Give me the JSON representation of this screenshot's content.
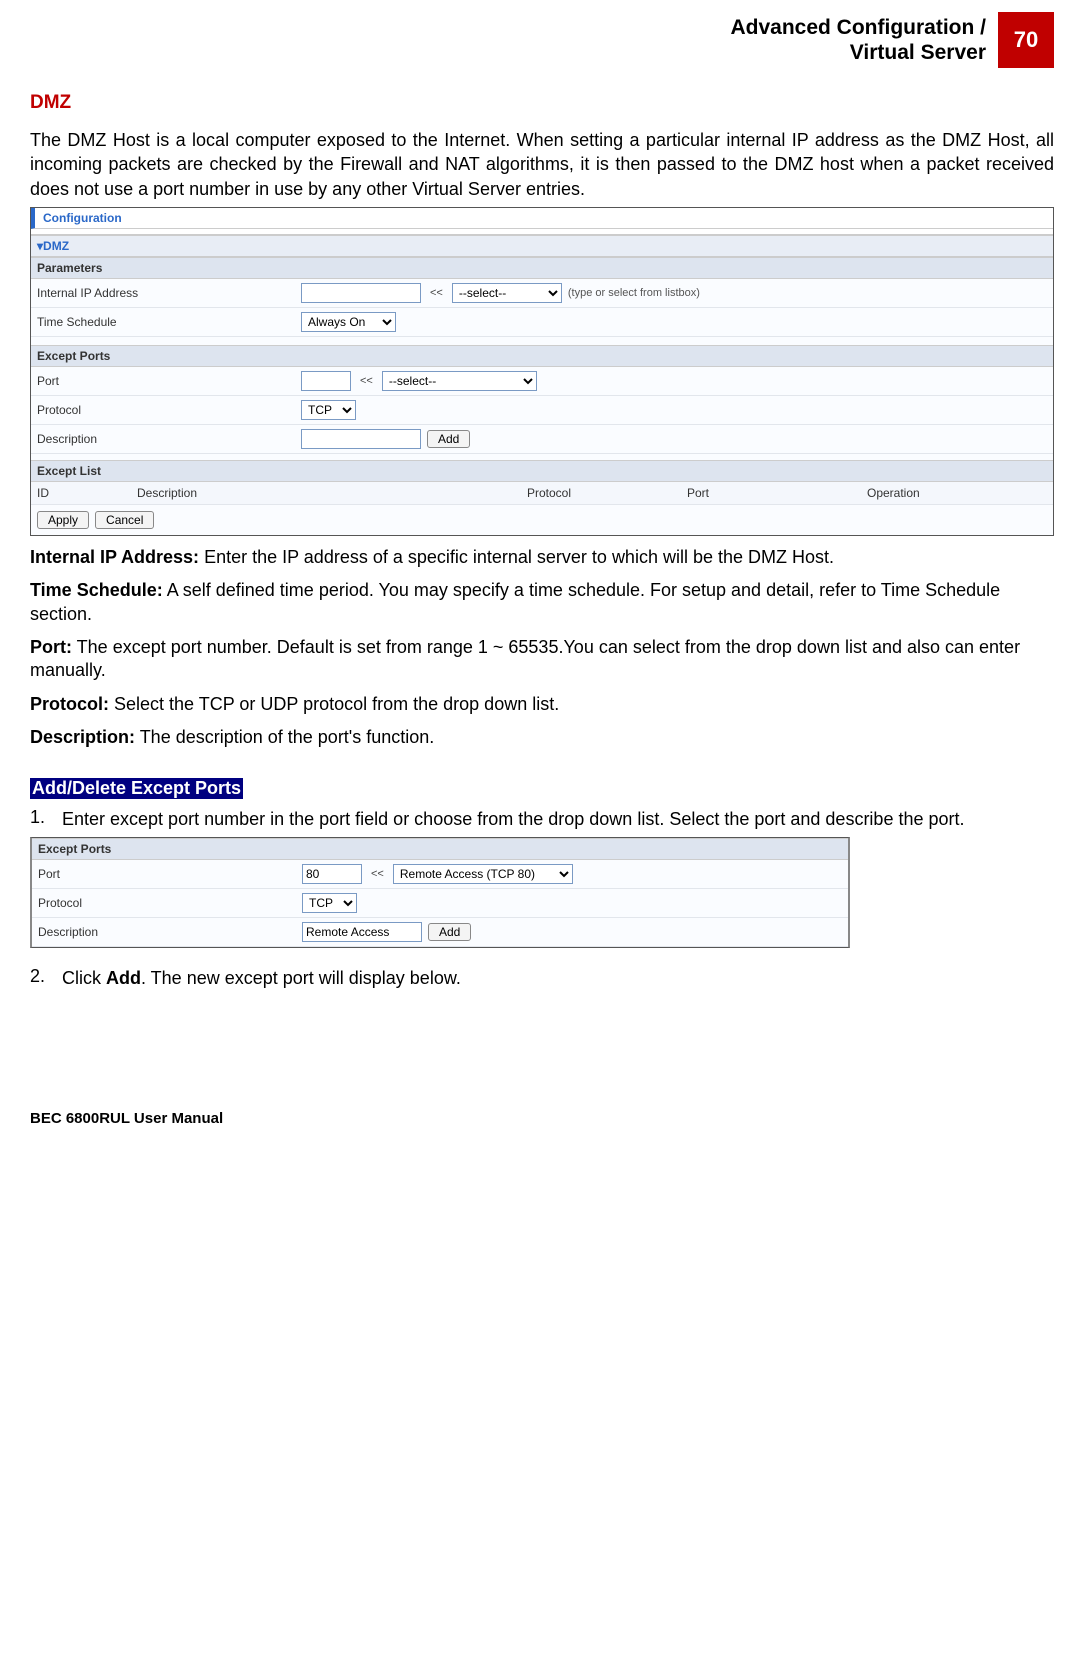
{
  "header": {
    "line1": "Advanced Configuration /",
    "line2": "Virtual Server",
    "page_number": "70"
  },
  "dmz_title": "DMZ",
  "intro": "The DMZ Host is a local computer exposed to the Internet. When setting a particular internal IP address as the DMZ Host, all incoming packets are checked by the Firewall and NAT algorithms, it is then passed to the DMZ host when a packet received does not use a port number in use by any other Virtual Server entries.",
  "ui1": {
    "config_tab": "Configuration",
    "dmz_section": "DMZ",
    "parameters": "Parameters",
    "rows": {
      "internal_ip_label": "Internal IP Address",
      "internal_ip_value": "",
      "ip_select_label": "--select--",
      "ip_hint": "(type or select from listbox)",
      "time_label": "Time Schedule",
      "time_value": "Always On"
    },
    "except_ports": "Except Ports",
    "port_label": "Port",
    "port_value": "",
    "port_select": "--select--",
    "protocol_label": "Protocol",
    "protocol_value": "TCP",
    "desc_label": "Description",
    "desc_value": "",
    "add_btn": "Add",
    "except_list": "Except List",
    "cols": {
      "id": "ID",
      "desc": "Description",
      "protocol": "Protocol",
      "port": "Port",
      "operation": "Operation"
    },
    "apply": "Apply",
    "cancel": "Cancel",
    "arrow": "<<"
  },
  "descs": {
    "ip_b": "Internal IP Address:",
    "ip_t": " Enter the IP address of a specific internal server to which will be the DMZ Host.",
    "ts_b": "Time Schedule:",
    "ts_t": " A self defined time period. You may specify a time schedule. For setup and detail, refer to Time Schedule section.",
    "port_b": "Port:",
    "port_t": " The except port number. Default is set from range 1 ~ 65535.You can select from the drop down list and also can enter manually.",
    "proto_b": "Protocol:",
    "proto_t": " Select the TCP or UDP protocol from the drop down list.",
    "desc_b": "Description:",
    "desc_t": " The description of the port's function."
  },
  "sub_header": "Add/Delete Except Ports",
  "step1": {
    "num": "1.",
    "text": "Enter except port number in the port field or choose from the drop down list. Select the port and describe the port."
  },
  "ui2": {
    "except_ports": "Except Ports",
    "port_label": "Port",
    "port_value": "80",
    "port_select": "Remote Access (TCP 80)",
    "protocol_label": "Protocol",
    "protocol_value": "TCP",
    "desc_label": "Description",
    "desc_value": "Remote Access",
    "add_btn": "Add",
    "arrow": "<<"
  },
  "step2": {
    "num": "2.",
    "pre": "Click ",
    "bold": "Add",
    "post": ". The new except port will display below."
  },
  "footer": "BEC 6800RUL User Manual"
}
